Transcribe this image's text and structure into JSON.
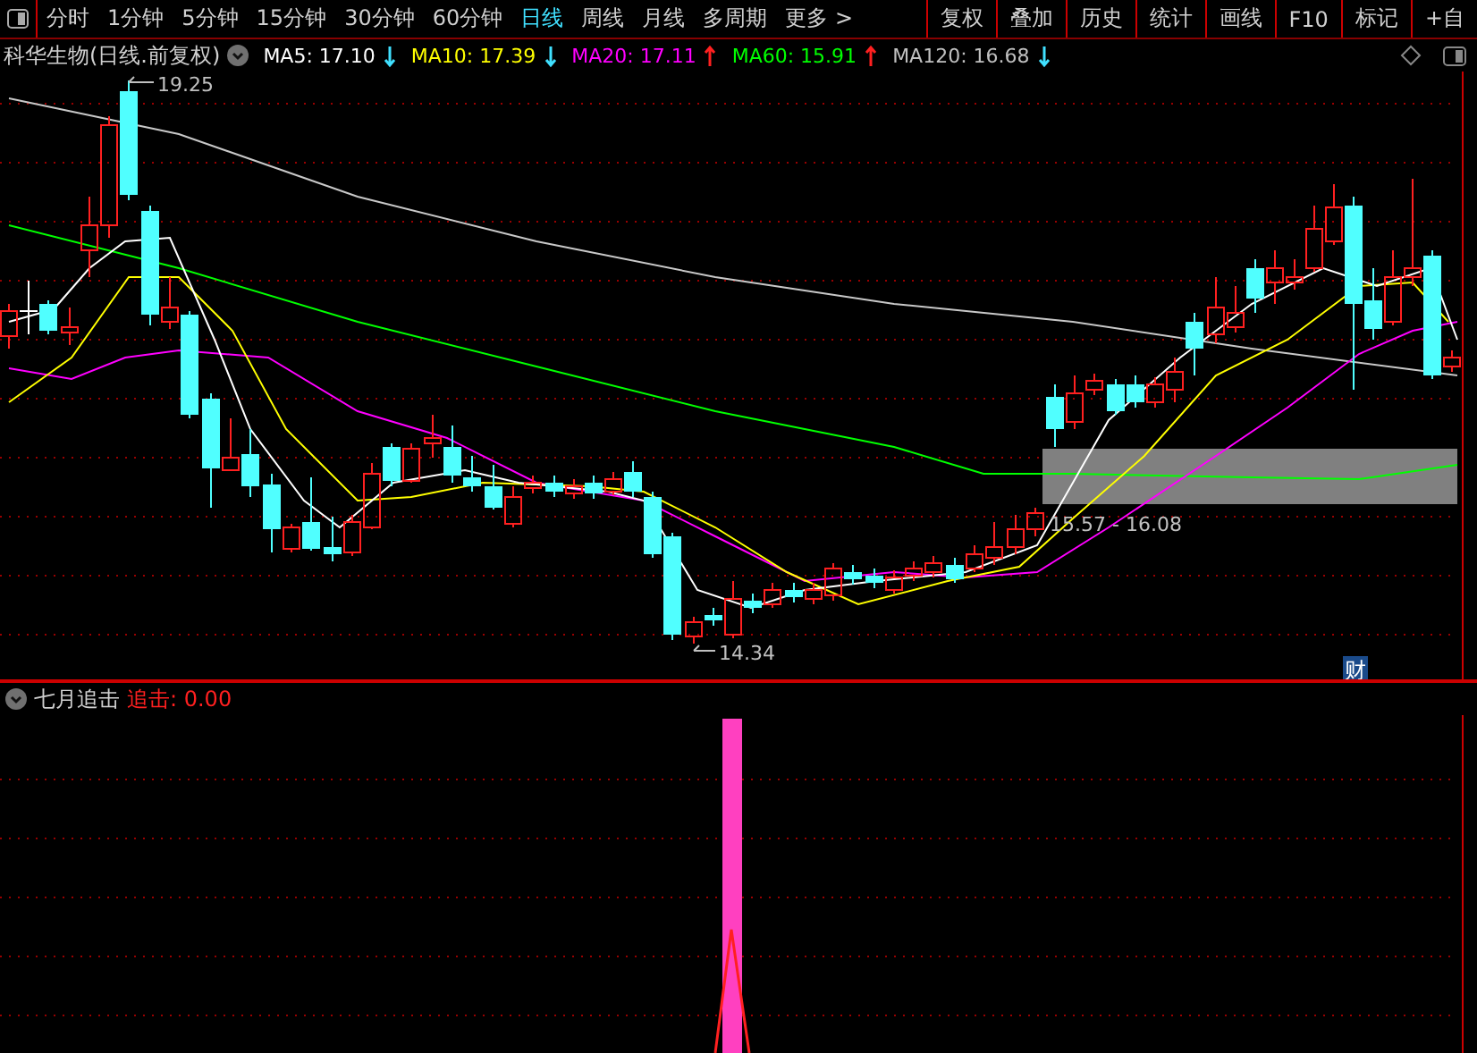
{
  "toolbar": {
    "periods": [
      {
        "label": "分时",
        "selected": false
      },
      {
        "label": "1分钟",
        "selected": false
      },
      {
        "label": "5分钟",
        "selected": false
      },
      {
        "label": "15分钟",
        "selected": false
      },
      {
        "label": "30分钟",
        "selected": false
      },
      {
        "label": "60分钟",
        "selected": false
      },
      {
        "label": "日线",
        "selected": true
      },
      {
        "label": "周线",
        "selected": false
      },
      {
        "label": "月线",
        "selected": false
      },
      {
        "label": "多周期",
        "selected": false
      }
    ],
    "more": "更多 >",
    "buttons": [
      "复权",
      "叠加",
      "历史",
      "统计",
      "画线",
      "F10",
      "标记",
      "+自"
    ]
  },
  "legend": {
    "title": "科华生物(日线.前复权)",
    "averages": [
      {
        "label": "MA5: 17.10",
        "color": "#ffffff",
        "rising": false
      },
      {
        "label": "MA10: 17.39",
        "color": "#ffff00",
        "rising": false
      },
      {
        "label": "MA20: 17.11",
        "color": "#ff00ff",
        "rising": true
      },
      {
        "label": "MA60: 15.91",
        "color": "#00ff00",
        "rising": true
      },
      {
        "label": "MA120: 16.68",
        "color": "#c0c0c0",
        "rising": false
      }
    ]
  },
  "chart": {
    "high_label": "19.25",
    "low_label": "14.34",
    "range_label": "15.57 - 16.08",
    "badge": "财"
  },
  "indicator": {
    "name": "七月追击",
    "value": "追击: 0.00"
  }
}
